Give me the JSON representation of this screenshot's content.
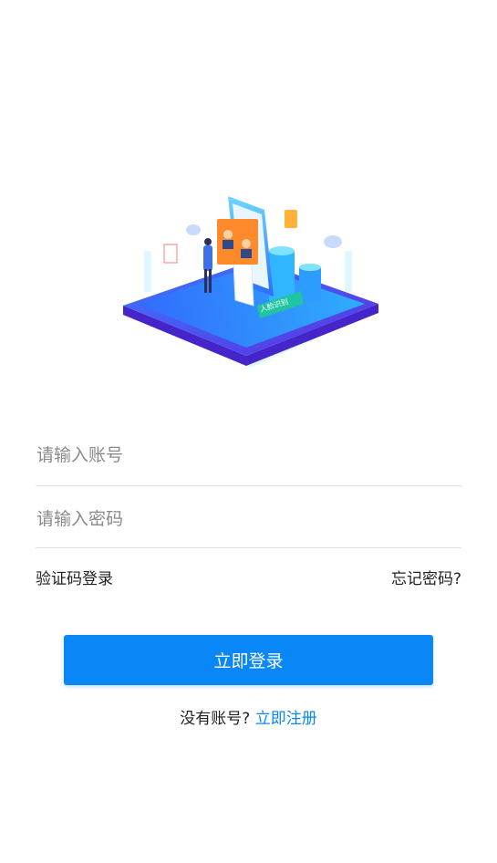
{
  "login": {
    "account_placeholder": "请输入账号",
    "password_placeholder": "请输入密码",
    "sms_login_label": "验证码登录",
    "forgot_password_label": "忘记密码?",
    "login_button_label": "立即登录",
    "no_account_text": "没有账号?",
    "register_link_label": "立即注册",
    "hero_badge_text": "人脸识别"
  },
  "colors": {
    "primary": "#0a87f7",
    "platform": "#4b3fe0"
  }
}
